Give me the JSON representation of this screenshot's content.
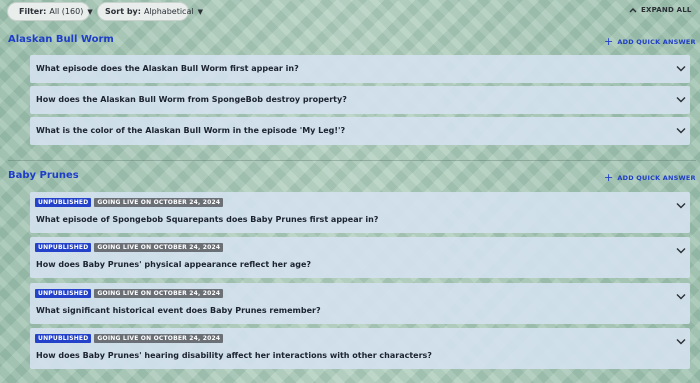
{
  "toolbar": {
    "filter_label": "Filter:",
    "filter_value": "All (160)",
    "sort_label": "Sort by:",
    "sort_value": "Alphabetical",
    "expand_all": "EXPAND ALL"
  },
  "groups": [
    {
      "title": "Alaskan Bull Worm",
      "add_label": "ADD QUICK ANSWER",
      "questions": [
        {
          "text": "What episode does the Alaskan Bull Worm first appear in?"
        },
        {
          "text": "How does the Alaskan Bull Worm from SpongeBob destroy property?"
        },
        {
          "text": "What is the color of the Alaskan Bull Worm in the episode 'My Leg!'?"
        }
      ]
    },
    {
      "title": "Baby Prunes",
      "add_label": "ADD QUICK ANSWER",
      "questions": [
        {
          "badge1": "UNPUBLISHED",
          "badge2": "GOING LIVE ON OCTOBER 24, 2024",
          "text": "What episode of Spongebob Squarepants does Baby Prunes first appear in?"
        },
        {
          "badge1": "UNPUBLISHED",
          "badge2": "GOING LIVE ON OCTOBER 24, 2024",
          "text": "How does Baby Prunes' physical appearance reflect her age?"
        },
        {
          "badge1": "UNPUBLISHED",
          "badge2": "GOING LIVE ON OCTOBER 24, 2024",
          "text": "What significant historical event does Baby Prunes remember?"
        },
        {
          "badge1": "UNPUBLISHED",
          "badge2": "GOING LIVE ON OCTOBER 24, 2024",
          "text": "How does Baby Prunes' hearing disability affect her interactions with other characters?"
        }
      ]
    }
  ],
  "colors": {
    "accent": "#1f3ec8",
    "unpublished_badge": "#2342c9",
    "golive_badge": "#6b6f76",
    "row_bg": "#d2e1ee"
  }
}
